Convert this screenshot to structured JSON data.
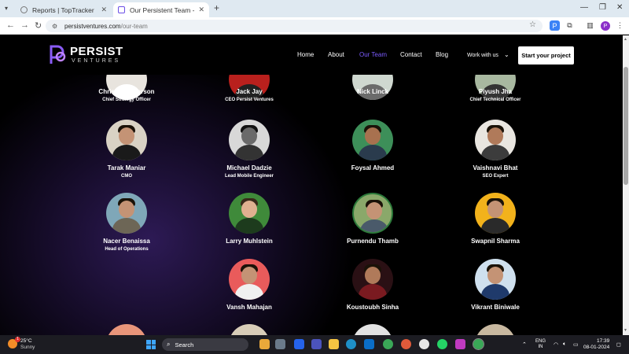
{
  "browser": {
    "tabs": [
      {
        "title": "Reports | TopTracker"
      },
      {
        "title": "Our Persistent Team - Persist Ve"
      }
    ],
    "url_host": "persistventures.com",
    "url_path": "/our-team"
  },
  "site": {
    "logo_text": "PERSIST",
    "logo_sub": "VENTURES",
    "menu": [
      "Home",
      "About",
      "Our Team",
      "Contact",
      "Blog",
      "Work with us"
    ],
    "cta": "Start your project"
  },
  "team": [
    {
      "name": "Christine Peterson",
      "role": "Chief Strategy Officer"
    },
    {
      "name": "Jack Jay",
      "role": "CEO Persist Ventures"
    },
    {
      "name": "Nick Linck",
      "role": ""
    },
    {
      "name": "Piyush Jha",
      "role": "Chief Technical Officer"
    },
    {
      "name": "Tarak Maniar",
      "role": "CMO"
    },
    {
      "name": "Michael Dadzie",
      "role": "Lead Mobile Engineer"
    },
    {
      "name": "Foysal Ahmed",
      "role": ""
    },
    {
      "name": "Vaishnavi Bhat",
      "role": "SEO Expert"
    },
    {
      "name": "Nacer Benaissa",
      "role": "Head of Operations"
    },
    {
      "name": "Larry Muhlstein",
      "role": ""
    },
    {
      "name": "Purnendu Thamb",
      "role": ""
    },
    {
      "name": "Swapnil Sharma",
      "role": ""
    },
    {
      "name": "Vansh Mahajan",
      "role": ""
    },
    {
      "name": "Koustoubh Sinha",
      "role": ""
    },
    {
      "name": "Vikrant Biniwale",
      "role": ""
    }
  ],
  "taskbar": {
    "temp": "25°C",
    "weather": "Sunny",
    "search": "Search",
    "lang_line1": "ENG",
    "lang_line2": "IN",
    "time": "17:39",
    "date": "08-01-2024"
  },
  "colors": {
    "accent": "#7c5cff",
    "page_bg": "#000000"
  }
}
